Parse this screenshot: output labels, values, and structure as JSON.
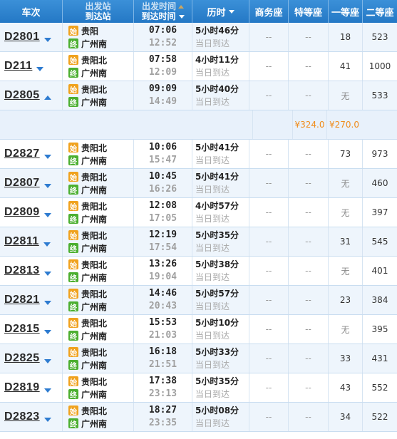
{
  "headers": {
    "train": "车次",
    "station_top": "出发站",
    "station_bottom": "到达站",
    "time_top": "出发时间",
    "time_bottom": "到达时间",
    "duration": "历时",
    "business": "商务座",
    "premium": "特等座",
    "first": "一等座",
    "second": "二等座"
  },
  "badge_start": "始",
  "badge_end": "终",
  "trains": [
    {
      "num": "D2801",
      "expanded": false,
      "from": "贵阳",
      "to": "广州南",
      "dep": "07:06",
      "arr": "12:52",
      "dur": "5小时46分",
      "arrive_note": "当日到达",
      "business": "--",
      "premium": "--",
      "first": "18",
      "second": "523"
    },
    {
      "num": "D211",
      "expanded": false,
      "from": "贵阳北",
      "to": "广州南",
      "dep": "07:58",
      "arr": "12:09",
      "dur": "4小时11分",
      "arrive_note": "当日到达",
      "business": "--",
      "premium": "--",
      "first": "41",
      "second": "1000"
    },
    {
      "num": "D2805",
      "expanded": true,
      "from": "贵阳北",
      "to": "广州南",
      "dep": "09:09",
      "arr": "14:49",
      "dur": "5小时40分",
      "arrive_note": "当日到达",
      "business": "--",
      "premium": "--",
      "first": "无",
      "second": "533"
    },
    {
      "num": "D2827",
      "expanded": false,
      "from": "贵阳北",
      "to": "广州南",
      "dep": "10:06",
      "arr": "15:47",
      "dur": "5小时41分",
      "arrive_note": "当日到达",
      "business": "--",
      "premium": "--",
      "first": "73",
      "second": "973"
    },
    {
      "num": "D2807",
      "expanded": false,
      "from": "贵阳北",
      "to": "广州南",
      "dep": "10:45",
      "arr": "16:26",
      "dur": "5小时41分",
      "arrive_note": "当日到达",
      "business": "--",
      "premium": "--",
      "first": "无",
      "second": "460"
    },
    {
      "num": "D2809",
      "expanded": false,
      "from": "贵阳北",
      "to": "广州南",
      "dep": "12:08",
      "arr": "17:05",
      "dur": "4小时57分",
      "arrive_note": "当日到达",
      "business": "--",
      "premium": "--",
      "first": "无",
      "second": "397"
    },
    {
      "num": "D2811",
      "expanded": false,
      "from": "贵阳北",
      "to": "广州南",
      "dep": "12:19",
      "arr": "17:54",
      "dur": "5小时35分",
      "arrive_note": "当日到达",
      "business": "--",
      "premium": "--",
      "first": "31",
      "second": "545"
    },
    {
      "num": "D2813",
      "expanded": false,
      "from": "贵阳北",
      "to": "广州南",
      "dep": "13:26",
      "arr": "19:04",
      "dur": "5小时38分",
      "arrive_note": "当日到达",
      "business": "--",
      "premium": "--",
      "first": "无",
      "second": "401"
    },
    {
      "num": "D2821",
      "expanded": false,
      "from": "贵阳北",
      "to": "广州南",
      "dep": "14:46",
      "arr": "20:43",
      "dur": "5小时57分",
      "arrive_note": "当日到达",
      "business": "--",
      "premium": "--",
      "first": "23",
      "second": "384"
    },
    {
      "num": "D2815",
      "expanded": false,
      "from": "贵阳北",
      "to": "广州南",
      "dep": "15:53",
      "arr": "21:03",
      "dur": "5小时10分",
      "arrive_note": "当日到达",
      "business": "--",
      "premium": "--",
      "first": "无",
      "second": "395"
    },
    {
      "num": "D2825",
      "expanded": false,
      "from": "贵阳北",
      "to": "广州南",
      "dep": "16:18",
      "arr": "21:51",
      "dur": "5小时33分",
      "arrive_note": "当日到达",
      "business": "--",
      "premium": "--",
      "first": "33",
      "second": "431"
    },
    {
      "num": "D2819",
      "expanded": false,
      "from": "贵阳北",
      "to": "广州南",
      "dep": "17:38",
      "arr": "23:13",
      "dur": "5小时35分",
      "arrive_note": "当日到达",
      "business": "--",
      "premium": "--",
      "first": "43",
      "second": "552"
    },
    {
      "num": "D2823",
      "expanded": false,
      "from": "贵阳北",
      "to": "广州南",
      "dep": "18:27",
      "arr": "23:35",
      "dur": "5小时08分",
      "arrive_note": "当日到达",
      "business": "--",
      "premium": "--",
      "first": "34",
      "second": "522"
    }
  ],
  "price_row": {
    "after": "D2805",
    "first": "¥324.0",
    "second": "¥270.0"
  },
  "colors": {
    "header": "#2478c5",
    "row_alt": "#eef5fc",
    "price": "#f08c1a",
    "start_badge": "#f0a21e",
    "end_badge": "#4caf30"
  }
}
